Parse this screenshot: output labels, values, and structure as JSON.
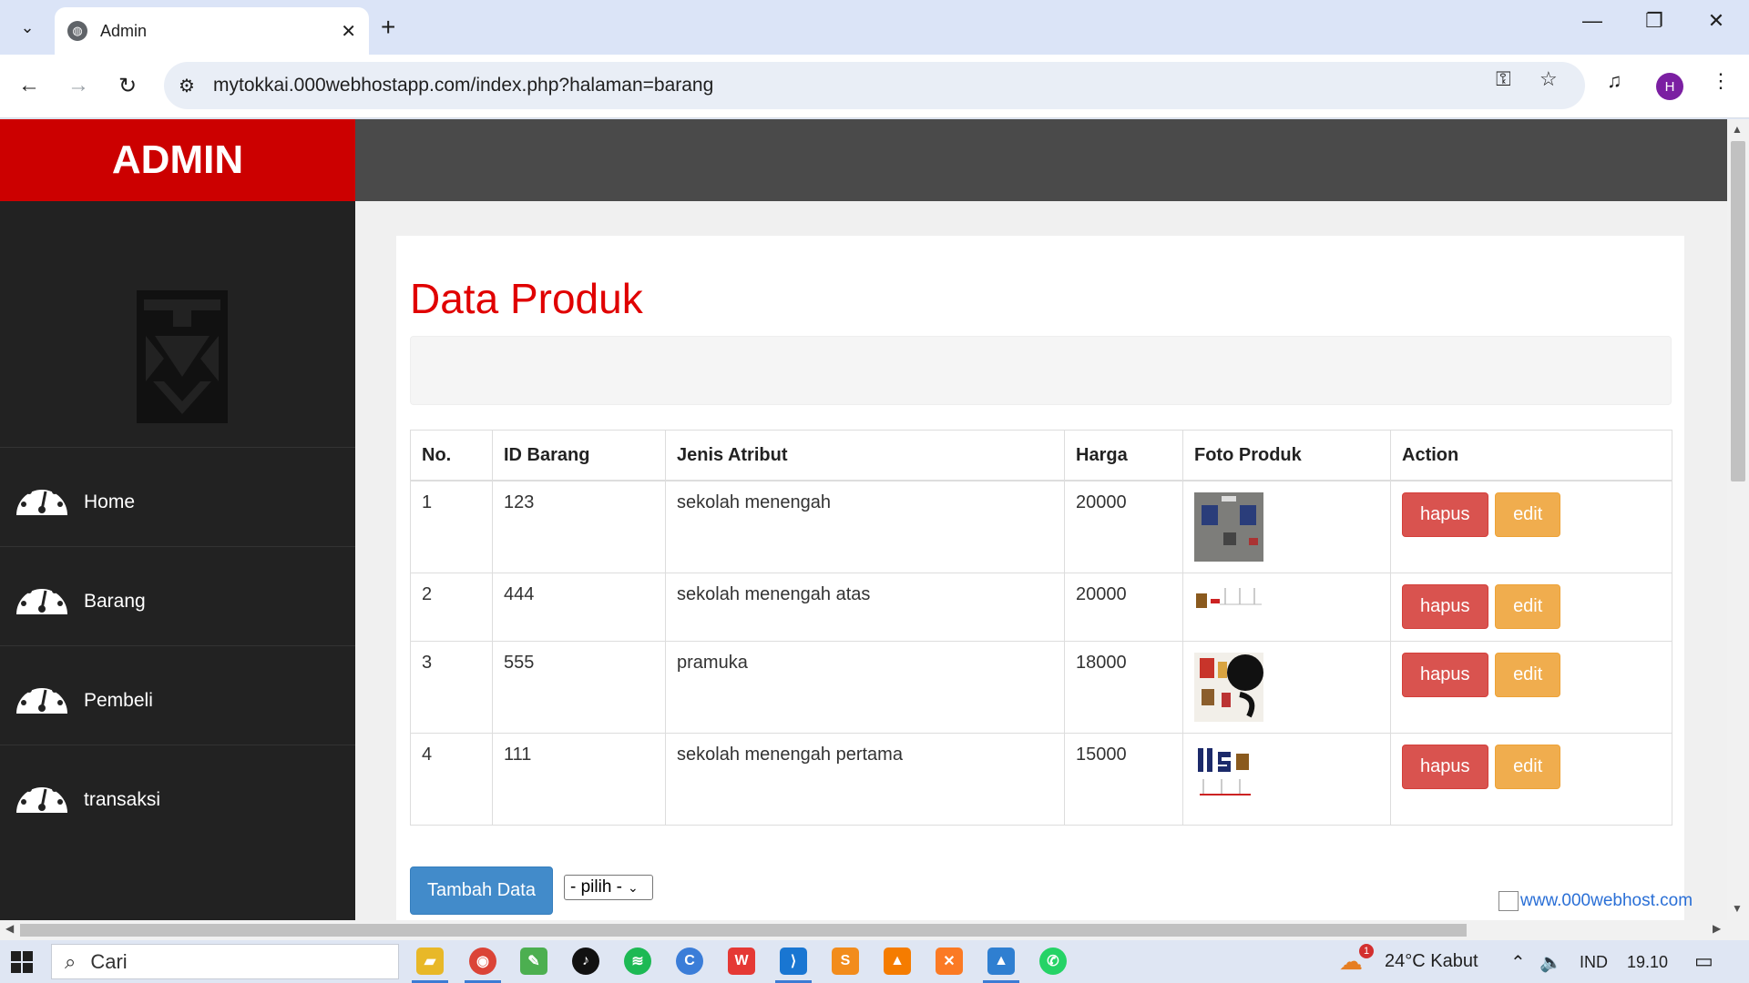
{
  "browser": {
    "tab_title": "Admin",
    "url": "mytokkai.000webhostapp.com/index.php?halaman=barang",
    "profile_initial": "H"
  },
  "header": {
    "brand": "ADMIN"
  },
  "sidebar": {
    "items": [
      {
        "label": "Home"
      },
      {
        "label": "Barang"
      },
      {
        "label": "Pembeli"
      },
      {
        "label": "transaksi"
      }
    ]
  },
  "main": {
    "title": "Data Produk",
    "table": {
      "headers": [
        "No.",
        "ID Barang",
        "Jenis Atribut",
        "Harga",
        "Foto Produk",
        "Action"
      ],
      "rows": [
        {
          "no": "1",
          "id": "123",
          "jenis": "sekolah menengah",
          "harga": "20000"
        },
        {
          "no": "2",
          "id": "444",
          "jenis": "sekolah menengah atas",
          "harga": "20000"
        },
        {
          "no": "3",
          "id": "555",
          "jenis": "pramuka",
          "harga": "18000"
        },
        {
          "no": "4",
          "id": "111",
          "jenis": "sekolah menengah pertama",
          "harga": "15000"
        }
      ],
      "delete_label": "hapus",
      "edit_label": "edit"
    },
    "add_button": "Tambah Data",
    "select_value": "- pilih -",
    "host_link": "www.000webhost.com"
  },
  "taskbar": {
    "search_label": "Cari",
    "weather": "24°C  Kabut",
    "language": "IND",
    "time": "19.10",
    "weather_badge": "1"
  },
  "colors": {
    "brand_red": "#cc0000",
    "title_red": "#e00000",
    "danger": "#d9534f",
    "warning": "#f0ad4e",
    "primary": "#428bca"
  }
}
